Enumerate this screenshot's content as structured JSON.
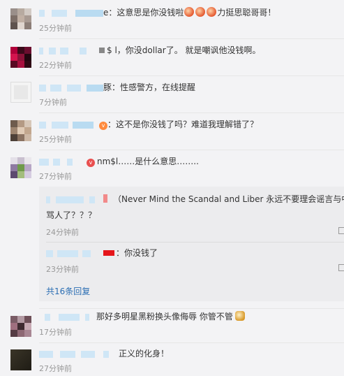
{
  "comments": [
    {
      "text": "e：这意思是你没钱啦",
      "text_tail": "力挺思聪哥哥！",
      "time": "25分钟前"
    },
    {
      "text": "$ l，你没dollar了。 就是嘲讽他没钱啊。",
      "time": "22分钟前"
    },
    {
      "text": "豚：性感警方，在线提醒",
      "time": "7分钟前"
    },
    {
      "text": "：这不是你没钱了吗？难道我理解错了？",
      "time": "25分钟前"
    },
    {
      "text": "nm$l……是什么意思……..",
      "time": "27分钟前"
    },
    {
      "text": "那好多明星黑粉换头像侮辱 你管不管",
      "time": "17分钟前"
    },
    {
      "text": "正义的化身！",
      "time": "27分钟前"
    }
  ],
  "replies": [
    {
      "text_line1": "（Never Mind the Scandal and Liber 永远不要理会谣言与中伤",
      "text_line2": "骂人了？？？",
      "time": "24分钟前"
    },
    {
      "text": "：你没钱了",
      "time": "23分钟前"
    }
  ],
  "reply_more": "共16条回复",
  "colors": {
    "link": "#2b6eb3",
    "time": "#999999",
    "text": "#333333"
  }
}
